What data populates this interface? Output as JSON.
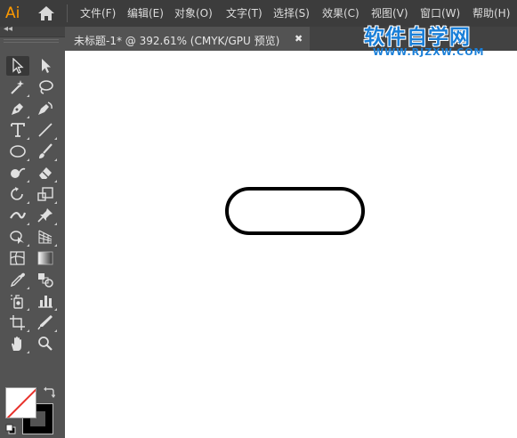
{
  "app": {
    "logo": "Ai"
  },
  "menu": {
    "items": [
      "文件(F)",
      "编辑(E)",
      "对象(O)",
      "文字(T)",
      "选择(S)",
      "效果(C)",
      "视图(V)",
      "窗口(W)",
      "帮助(H)"
    ]
  },
  "tools_panel": {
    "collapse_label": "◂◂",
    "tools": [
      "selection-tool",
      "direct-selection-tool",
      "magic-wand-tool",
      "lasso-tool",
      "pen-tool",
      "curvature-tool",
      "type-tool",
      "line-segment-tool",
      "ellipse-tool",
      "paintbrush-tool",
      "shaper-tool",
      "eraser-tool",
      "rotate-tool",
      "scale-tool",
      "width-tool",
      "puppet-warp-tool",
      "shape-builder-tool",
      "perspective-grid-tool",
      "mesh-tool",
      "gradient-tool",
      "eyedropper-tool",
      "blend-tool",
      "symbol-sprayer-tool",
      "column-graph-tool",
      "artboard-tool",
      "slice-tool",
      "hand-tool",
      "zoom-tool"
    ],
    "active_tool": "selection-tool",
    "fill": "none",
    "stroke": "#000000"
  },
  "document": {
    "tab_title": "未标题-1* @ 392.61% (CMYK/GPU 预览)",
    "close_label": "✖"
  },
  "watermark": {
    "text": "软件自学网",
    "url": "WWW.RJZXW.COM",
    "color": "#1a7fd8"
  },
  "canvas": {
    "background": "#ffffff",
    "shape": "rounded-rectangle",
    "stroke_color": "#000000"
  }
}
